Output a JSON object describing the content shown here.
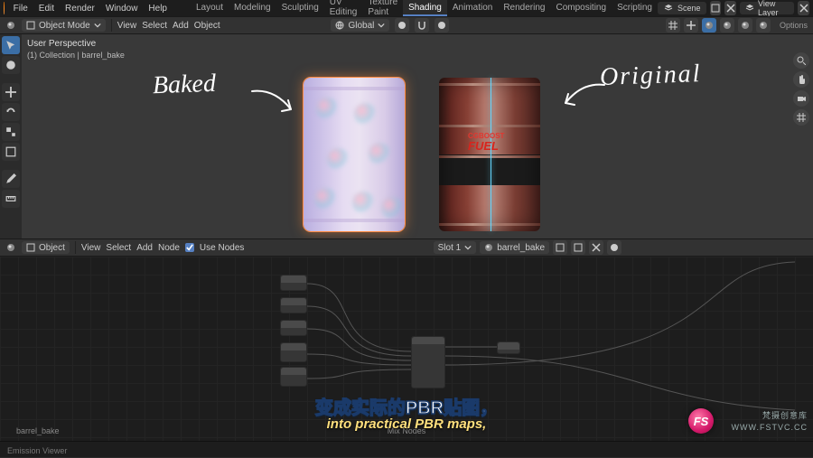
{
  "app": {
    "title": "Blender",
    "menus": [
      "File",
      "Edit",
      "Render",
      "Window",
      "Help"
    ]
  },
  "workspaces": {
    "tabs": [
      "Layout",
      "Modeling",
      "Sculpting",
      "UV Editing",
      "Texture Paint",
      "Shading",
      "Animation",
      "Rendering",
      "Compositing",
      "Scripting"
    ],
    "active": "Shading"
  },
  "scene_switch": {
    "scene_label": "Scene",
    "viewlayer_label": "View Layer"
  },
  "tool_header": {
    "mode": "Object Mode",
    "menus": [
      "View",
      "Select",
      "Add",
      "Object"
    ],
    "orientation": "Global",
    "options_label": "Options"
  },
  "viewport": {
    "perspective_line1": "User Perspective",
    "perspective_line2": "(1) Collection | barrel_bake",
    "handwrite_baked": "Baked",
    "handwrite_original": "Original",
    "barrel_brand_line1": "CGBOOST",
    "barrel_brand_line2": "FUEL"
  },
  "subtitle": {
    "line_cn": "变成实际的PBR贴图，",
    "line_en": "into practical PBR maps,"
  },
  "branding": {
    "logo_text": "FS",
    "logo_sub": "梵摄创意库",
    "domain": "WWW.FSTVC.CC"
  },
  "node_header": {
    "shading_mode": "Object",
    "menus": [
      "View",
      "Select",
      "Add",
      "Node"
    ],
    "use_nodes_label": "Use Nodes",
    "use_nodes_checked": true,
    "slot_label": "Slot 1",
    "material": "barrel_bake"
  },
  "node_editor": {
    "label_left": "barrel_bake",
    "label_mid": "Mix Nodes"
  },
  "status": {
    "label": "Emission Viewer"
  },
  "icons": {
    "scene": "scene-icon",
    "viewlayer": "layers-icon",
    "global": "globe-icon",
    "snap": "magnet-icon",
    "overlay": "overlay-icon",
    "shading": "sphere-icon",
    "camera": "camera-icon",
    "grid": "grid-icon",
    "hand": "hand-icon",
    "zoom": "zoom-icon",
    "pin": "pin-icon",
    "close": "close-icon",
    "chevron": "chevron-down-icon",
    "new": "file-icon",
    "shield": "shield-icon",
    "cursor": "cursor-icon",
    "select": "select-box-icon",
    "move": "move-icon",
    "rotate": "rotate-icon",
    "scale": "scale-icon",
    "transform": "transform-icon",
    "annotate": "annotate-icon",
    "measure": "measure-icon"
  }
}
